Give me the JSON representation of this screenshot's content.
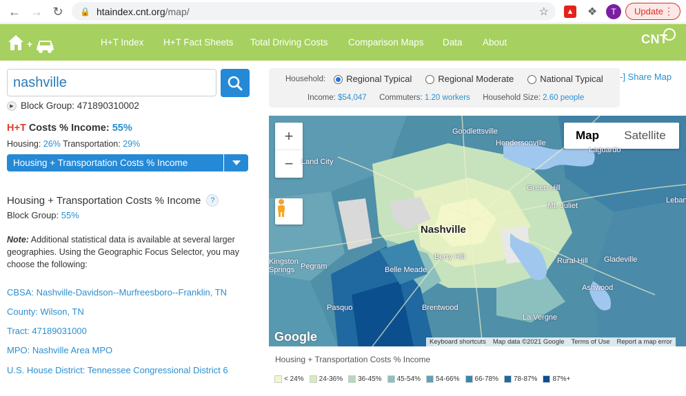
{
  "browser": {
    "url_host": "htaindex.cnt.org",
    "url_path": "/map/",
    "avatar_letter": "T",
    "update_label": "Update"
  },
  "nav": {
    "items": [
      "H+T Index",
      "H+T Fact Sheets",
      "Total Driving Costs",
      "Comparison Maps",
      "Data",
      "About"
    ],
    "brand": "CNT"
  },
  "search": {
    "value": "nashville"
  },
  "block_group": {
    "label": "Block Group: 471890310002",
    "ht_prefix": "H+T",
    "ht_label": "Costs % Income:",
    "ht_value": "55%",
    "housing_label": "Housing:",
    "housing_value": "26%",
    "transport_label": "Transportation:",
    "transport_value": "29%",
    "dropdown_label": "Housing + Transportation Costs % Income",
    "section_title": "Housing + Transportation Costs % Income",
    "section_help": "?",
    "bg_label": "Block Group:",
    "bg_value": "55%",
    "note_prefix": "Note:",
    "note_text": "Additional statistical data is available at several larger geographies. Using the Geographic Focus Selector, you may choose the following:"
  },
  "geo_links": [
    "CBSA: Nashville-Davidson--Murfreesboro--Franklin, TN",
    "County: Wilson, TN",
    "Tract: 47189031000",
    "MPO: Nashville Area MPO",
    "U.S. House District: Tennessee Congressional District 6"
  ],
  "household": {
    "label": "Household:",
    "options": [
      "Regional Typical",
      "Regional Moderate",
      "National Typical"
    ],
    "selected": 0,
    "income_label": "Income:",
    "income_value": "$54,047",
    "commuters_label": "Commuters:",
    "commuters_value": "1.20 workers",
    "size_label": "Household Size:",
    "size_value": "2.60 people"
  },
  "share_map": "-] Share Map",
  "map": {
    "zoom_in": "+",
    "zoom_out": "−",
    "type_map": "Map",
    "type_satellite": "Satellite",
    "google": "Google",
    "city": "Nashville",
    "places": [
      "Goodlettsville",
      "Hendersonville",
      "Laguardo",
      "Green Hill",
      "Mt. Juliet",
      "Lebanon",
      "Rural Hill",
      "Gladeville",
      "Ashwood",
      "La Vergne",
      "Brentwood",
      "Berry Hill",
      "Belle Meade",
      "Pegram",
      "Kingston Springs",
      "Pasquo",
      "Land City"
    ],
    "attribution": [
      "Keyboard shortcuts",
      "Map data ©2021 Google",
      "Terms of Use",
      "Report a map error"
    ]
  },
  "legend": {
    "title": "Housing + Transportation Costs % Income",
    "items": [
      {
        "label": "< 24%",
        "color": "#f4f7c9"
      },
      {
        "label": "24-36%",
        "color": "#d7ebbd"
      },
      {
        "label": "36-45%",
        "color": "#b7d8bd"
      },
      {
        "label": "45-54%",
        "color": "#8cc0bf"
      },
      {
        "label": "54-66%",
        "color": "#5fa2b8"
      },
      {
        "label": "66-78%",
        "color": "#3b86ae"
      },
      {
        "label": "78-87%",
        "color": "#2068a0"
      },
      {
        "label": "87%+",
        "color": "#0b4f8f"
      }
    ]
  },
  "colors": {
    "accent": "#2589d6",
    "nav_bg": "#a6d05f",
    "ht_red": "#d9412b"
  }
}
